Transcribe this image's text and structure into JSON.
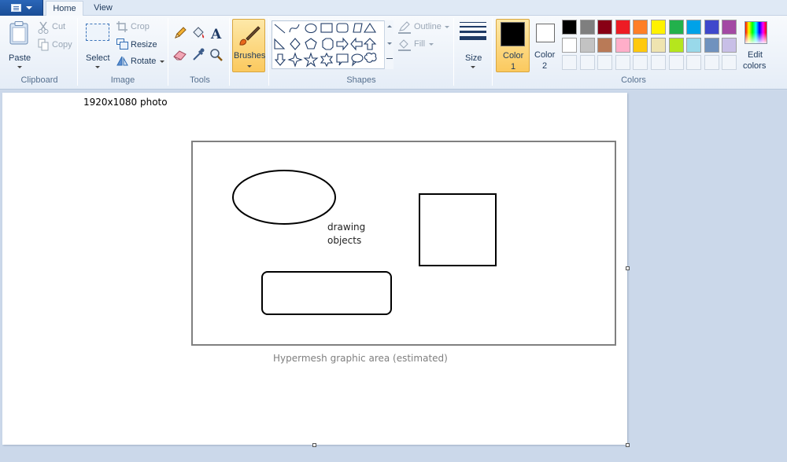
{
  "tabs": {
    "home": "Home",
    "view": "View"
  },
  "clipboard": {
    "paste": "Paste",
    "cut": "Cut",
    "copy": "Copy",
    "group": "Clipboard"
  },
  "image": {
    "select": "Select",
    "crop": "Crop",
    "resize": "Resize",
    "rotate": "Rotate",
    "group": "Image"
  },
  "tools": {
    "group": "Tools"
  },
  "brushes": {
    "label": "Brushes"
  },
  "shapes": {
    "outline": "Outline",
    "fill": "Fill",
    "group": "Shapes"
  },
  "size": {
    "label": "Size"
  },
  "colors": {
    "color1_label": "Color",
    "color1_num": "1",
    "color2_label": "Color",
    "color2_num": "2",
    "edit_line1": "Edit",
    "edit_line2": "colors",
    "group": "Colors",
    "color1_value": "#000000",
    "color2_value": "#ffffff",
    "palette_row1": [
      "#000000",
      "#7f7f7f",
      "#880015",
      "#ed1c24",
      "#ff7f27",
      "#fff200",
      "#22b14c",
      "#00a2e8",
      "#3f48cc",
      "#a349a4"
    ],
    "palette_row2": [
      "#ffffff",
      "#c3c3c3",
      "#b97a57",
      "#ffaec9",
      "#ffc90e",
      "#efe4b0",
      "#b5e61d",
      "#99d9ea",
      "#7092be",
      "#c8bfe7"
    ]
  },
  "canvas": {
    "photo_label": "1920x1080 photo",
    "objects_line1": "drawing",
    "objects_line2": "objects",
    "area_caption": "Hypermesh graphic area (estimated)"
  }
}
